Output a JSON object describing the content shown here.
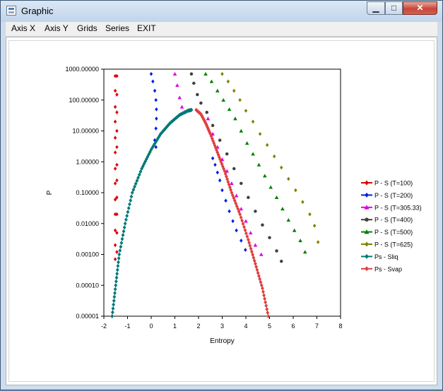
{
  "window": {
    "title": "Graphic",
    "minimize_glyph": "▁",
    "maximize_glyph": "□",
    "close_glyph": "✕"
  },
  "menu": [
    {
      "label": "Axis X"
    },
    {
      "label": "Axis Y"
    },
    {
      "label": "Grids"
    },
    {
      "label": "Series"
    },
    {
      "label": "EXIT"
    }
  ],
  "chart_data": {
    "type": "scatter",
    "title": "",
    "xlabel": "Entropy",
    "ylabel": "P",
    "xlim": [
      -2,
      8
    ],
    "ylim": [
      1e-05,
      1000
    ],
    "y_scale": "log",
    "x_ticks": [
      "-2",
      "-1",
      "0",
      "1",
      "2",
      "3",
      "4",
      "5",
      "6",
      "7",
      "8"
    ],
    "y_ticks": [
      "0.00001",
      "0.00010",
      "0.00100",
      "0.01000",
      "0.10000",
      "1.00000",
      "10.00000",
      "100.00000",
      "1000.00000"
    ],
    "grid": false,
    "legend_position": "right",
    "series": [
      {
        "name": "P - S (T=100)",
        "color": "#e00000",
        "marker": "diamond",
        "points": [
          [
            -1.52,
            600
          ],
          [
            -1.52,
            200
          ],
          [
            -1.52,
            60
          ],
          [
            -1.52,
            20
          ],
          [
            -1.52,
            6
          ],
          [
            -1.52,
            2
          ],
          [
            -1.52,
            0.6
          ],
          [
            -1.52,
            0.2
          ],
          [
            -1.52,
            0.06
          ],
          [
            -1.52,
            0.02
          ],
          [
            -1.52,
            0.006
          ],
          [
            -1.52,
            0.002
          ],
          [
            -1.52,
            0.0007
          ],
          [
            -1.45,
            600
          ],
          [
            -1.45,
            150
          ],
          [
            -1.45,
            40
          ],
          [
            -1.45,
            10
          ],
          [
            -1.45,
            3
          ],
          [
            -1.45,
            0.8
          ],
          [
            -1.45,
            0.25
          ],
          [
            -1.45,
            0.07
          ],
          [
            -1.45,
            0.02
          ],
          [
            -1.45,
            0.005
          ],
          [
            -1.45,
            0.0012
          ]
        ]
      },
      {
        "name": "P - S (T=200)",
        "color": "#0020e0",
        "marker": "diamond",
        "points": [
          [
            0.0,
            700
          ],
          [
            0.07,
            400
          ],
          [
            0.15,
            200
          ],
          [
            0.2,
            100
          ],
          [
            0.22,
            50
          ],
          [
            0.22,
            25
          ],
          [
            0.2,
            12
          ],
          [
            0.15,
            5
          ],
          [
            0.2,
            3
          ],
          [
            2.6,
            1.3
          ],
          [
            2.7,
            0.8
          ],
          [
            2.8,
            0.45
          ],
          [
            2.9,
            0.25
          ],
          [
            3.0,
            0.12
          ],
          [
            3.15,
            0.055
          ],
          [
            3.3,
            0.025
          ],
          [
            3.45,
            0.012
          ],
          [
            3.6,
            0.006
          ],
          [
            3.8,
            0.0028
          ],
          [
            3.98,
            0.0014
          ]
        ]
      },
      {
        "name": "P - S (T=305.33)",
        "color": "#e000e0",
        "marker": "triangle",
        "points": [
          [
            1.0,
            700
          ],
          [
            1.1,
            300
          ],
          [
            1.2,
            120
          ],
          [
            1.3,
            60
          ],
          [
            1.4,
            40
          ],
          [
            2.4,
            25
          ],
          [
            2.6,
            8
          ],
          [
            2.8,
            3
          ],
          [
            3.0,
            1.2
          ],
          [
            3.2,
            0.5
          ],
          [
            3.4,
            0.2
          ],
          [
            3.6,
            0.08
          ],
          [
            3.8,
            0.03
          ],
          [
            4.0,
            0.012
          ],
          [
            4.2,
            0.005
          ],
          [
            4.4,
            0.002
          ],
          [
            4.65,
            0.001
          ]
        ]
      },
      {
        "name": "P - S (T=400)",
        "color": "#404040",
        "marker": "circle",
        "points": [
          [
            1.7,
            700
          ],
          [
            1.8,
            350
          ],
          [
            1.95,
            150
          ],
          [
            2.1,
            80
          ],
          [
            2.35,
            40
          ],
          [
            2.6,
            15
          ],
          [
            2.9,
            5
          ],
          [
            3.2,
            1.8
          ],
          [
            3.5,
            0.6
          ],
          [
            3.8,
            0.2
          ],
          [
            4.1,
            0.07
          ],
          [
            4.4,
            0.025
          ],
          [
            4.7,
            0.009
          ],
          [
            5.0,
            0.0035
          ],
          [
            5.3,
            0.0013
          ],
          [
            5.5,
            0.0006
          ]
        ]
      },
      {
        "name": "P - S (T=500)",
        "color": "#008000",
        "marker": "triangle",
        "points": [
          [
            2.3,
            700
          ],
          [
            2.55,
            400
          ],
          [
            2.8,
            200
          ],
          [
            3.05,
            100
          ],
          [
            3.3,
            50
          ],
          [
            3.55,
            25
          ],
          [
            3.8,
            10
          ],
          [
            4.05,
            4
          ],
          [
            4.3,
            1.8
          ],
          [
            4.55,
            0.8
          ],
          [
            4.8,
            0.35
          ],
          [
            5.05,
            0.15
          ],
          [
            5.3,
            0.07
          ],
          [
            5.55,
            0.03
          ],
          [
            5.8,
            0.013
          ],
          [
            6.05,
            0.006
          ],
          [
            6.3,
            0.0028
          ],
          [
            6.5,
            0.0012
          ]
        ]
      },
      {
        "name": "P - S (T=625)",
        "color": "#808000",
        "marker": "diamond",
        "points": [
          [
            3.0,
            700
          ],
          [
            3.25,
            400
          ],
          [
            3.5,
            200
          ],
          [
            3.75,
            100
          ],
          [
            4.0,
            45
          ],
          [
            4.3,
            20
          ],
          [
            4.6,
            8
          ],
          [
            4.9,
            3.5
          ],
          [
            5.2,
            1.5
          ],
          [
            5.5,
            0.65
          ],
          [
            5.8,
            0.28
          ],
          [
            6.1,
            0.12
          ],
          [
            6.4,
            0.05
          ],
          [
            6.7,
            0.02
          ],
          [
            6.9,
            0.0085
          ],
          [
            7.05,
            0.0025
          ]
        ]
      },
      {
        "name": "Ps - Sliq",
        "color": "#007878",
        "marker": "diamond",
        "points": [
          [
            -1.65,
            1e-05
          ],
          [
            -1.5,
            0.0001
          ],
          [
            -1.35,
            0.001
          ],
          [
            -1.1,
            0.01
          ],
          [
            -0.8,
            0.1
          ],
          [
            -0.4,
            0.6
          ],
          [
            0.0,
            2.5
          ],
          [
            0.4,
            8
          ],
          [
            0.8,
            18
          ],
          [
            1.2,
            33
          ],
          [
            1.55,
            45
          ],
          [
            1.7,
            48
          ]
        ]
      },
      {
        "name": "Ps - Svap",
        "color": "#e04040",
        "marker": "diamond",
        "points": [
          [
            1.9,
            48
          ],
          [
            2.1,
            35
          ],
          [
            2.3,
            18
          ],
          [
            2.5,
            8
          ],
          [
            2.8,
            2
          ],
          [
            3.1,
            0.5
          ],
          [
            3.4,
            0.1
          ],
          [
            3.75,
            0.02
          ],
          [
            4.1,
            0.003
          ],
          [
            4.4,
            0.0005
          ],
          [
            4.7,
            8e-05
          ],
          [
            4.95,
            1e-05
          ]
        ]
      }
    ]
  }
}
